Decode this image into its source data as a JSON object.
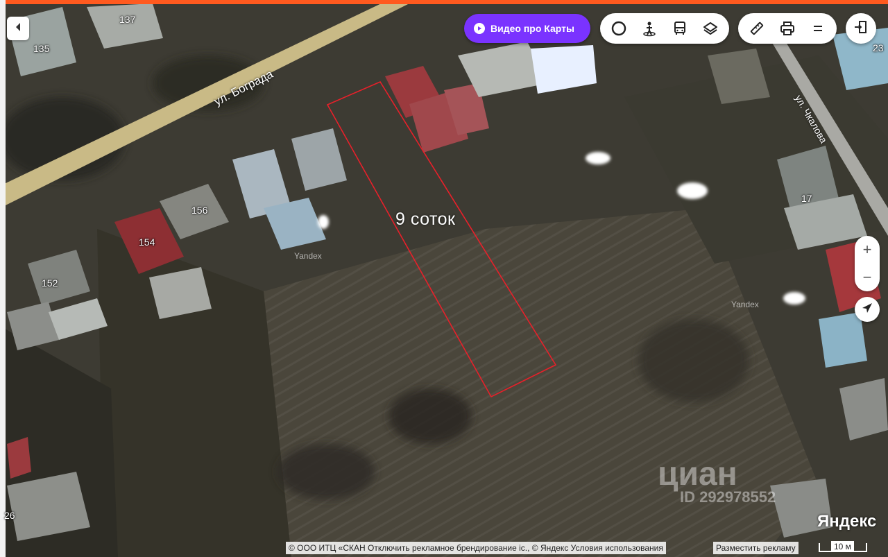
{
  "map": {
    "street_labels": [
      "ул. Бограда",
      "ул. Чкалова"
    ],
    "house_numbers": [
      "137",
      "135",
      "156",
      "154",
      "152",
      "17",
      "23",
      "26"
    ],
    "plot_label": "9 соток",
    "plot_outline_color": "#e8202a",
    "watermarks": [
      "Yandex",
      "Yandex"
    ]
  },
  "controls": {
    "video_button": "Видео про Карты",
    "layer_icons": [
      "traffic-circle-icon",
      "panorama-person-icon",
      "transit-bus-icon",
      "layers-icon"
    ],
    "tool_icons": [
      "ruler-icon",
      "print-icon",
      "menu-icon"
    ],
    "zoom_in": "+",
    "zoom_out": "−",
    "accent_color": "#7a33ff"
  },
  "overlay": {
    "cian_logo": "циан",
    "cian_id": "ID 292978552"
  },
  "footer": {
    "copyright": "© ООО ИТЦ «СКАН  Отключить рекламное брендирование іс., © Яндекс Условия использования",
    "ad_link": "Разместить рекламу",
    "brand": "Яндекс",
    "scale": "10 м"
  }
}
